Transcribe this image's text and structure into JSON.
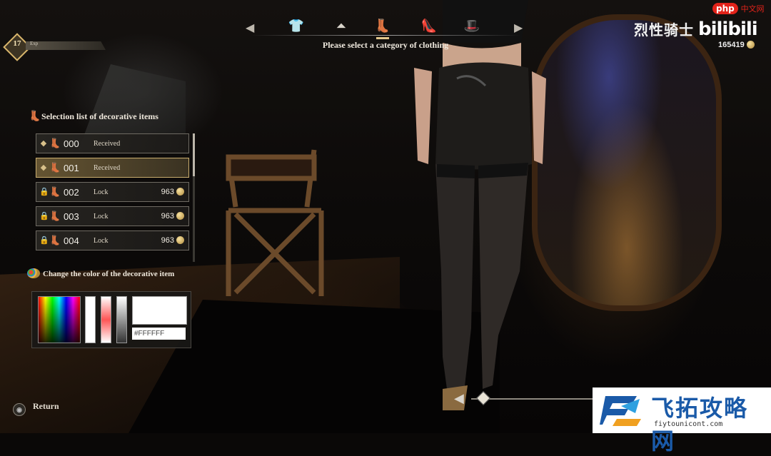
{
  "header": {
    "prompt": "Please select a category of clothing",
    "categories": [
      "shirt-icon",
      "skirt-icon",
      "stockings-icon",
      "high-heel-icon",
      "hat-icon"
    ],
    "active_category": "stockings-icon"
  },
  "player": {
    "level": "17",
    "xp_label": "Exp"
  },
  "brand": {
    "game_name": "烈性骑士",
    "platform": "bilibili",
    "site_badge": "php",
    "site_suffix": "中文网"
  },
  "currency": {
    "amount": "165419"
  },
  "items_panel": {
    "title": "Selection list of decorative items",
    "items": [
      {
        "code": "000",
        "status": "Received",
        "price": "",
        "locked": false,
        "selected": false
      },
      {
        "code": "001",
        "status": "Received",
        "price": "",
        "locked": false,
        "selected": true
      },
      {
        "code": "002",
        "status": "Lock",
        "price": "963",
        "locked": true,
        "selected": false
      },
      {
        "code": "003",
        "status": "Lock",
        "price": "963",
        "locked": true,
        "selected": false
      },
      {
        "code": "004",
        "status": "Lock",
        "price": "963",
        "locked": true,
        "selected": false
      }
    ]
  },
  "color_panel": {
    "title": "Change the color of the decorative item",
    "hex_value": "#FFFFFF",
    "preview_color": "#FFFFFF"
  },
  "footer": {
    "return_label": "Return"
  },
  "watermark": {
    "cn_text": "飞拓攻略网",
    "url": "fiytounicont.com"
  },
  "colors": {
    "accent_gold": "#d9b66c",
    "selected_row": "#695834",
    "watermark_blue": "#1a5aa8"
  }
}
